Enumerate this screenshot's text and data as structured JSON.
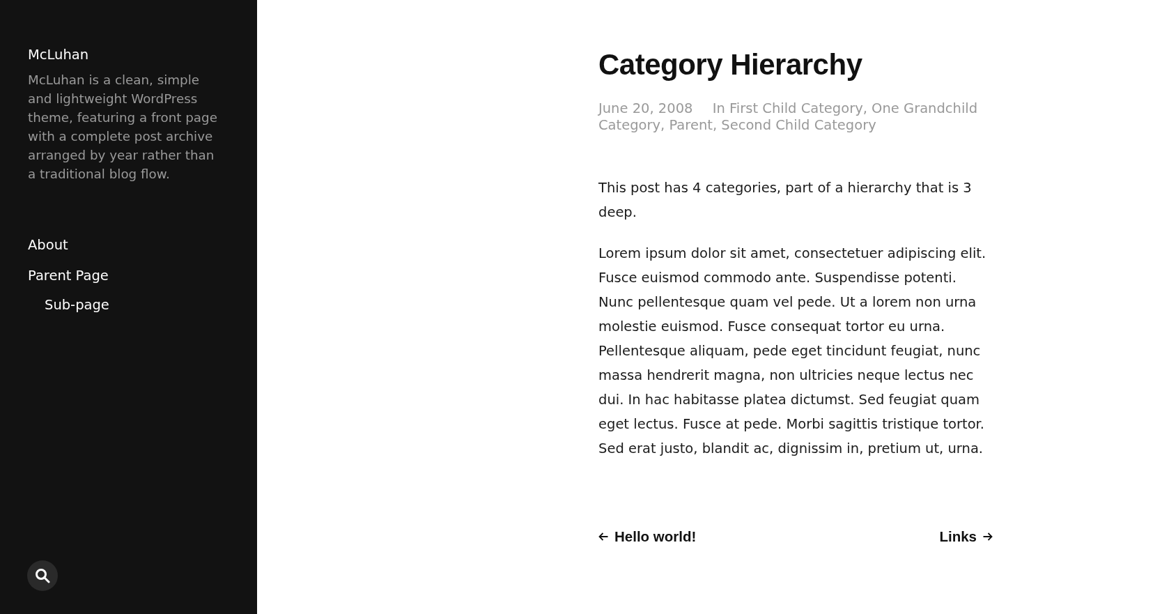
{
  "sidebar": {
    "site_title": "McLuhan",
    "description": "McLuhan is a clean, simple and lightweight WordPress theme, featuring a front page with a complete post archive arranged by year rather than a traditional blog flow.",
    "menu": [
      {
        "label": "About"
      },
      {
        "label": "Parent Page",
        "children": [
          {
            "label": "Sub-page"
          }
        ]
      }
    ]
  },
  "post": {
    "title": "Category Hierarchy",
    "date": "June 20, 2008",
    "categories": "In First Child Category, One Grandchild Category, Parent, Second Child Category",
    "paragraphs": [
      "This post has 4 categories, part of a hierarchy that is 3 deep.",
      "Lorem ipsum dolor sit amet, consectetuer adipiscing elit. Fusce euismod commodo ante. Suspendisse potenti. Nunc pellentesque quam vel pede. Ut a lorem non urna molestie euismod. Fusce consequat tortor eu urna. Pellentesque aliquam, pede eget tincidunt feugiat, nunc massa hendrerit magna, non ultricies neque lectus nec dui. In hac habitasse platea dictumst. Sed feugiat quam eget lectus. Fusce at pede. Morbi sagittis tristique tortor. Sed erat justo, blandit ac, dignissim in, pretium ut, urna."
    ]
  },
  "post_nav": {
    "previous": "Hello world!",
    "next": "Links"
  }
}
